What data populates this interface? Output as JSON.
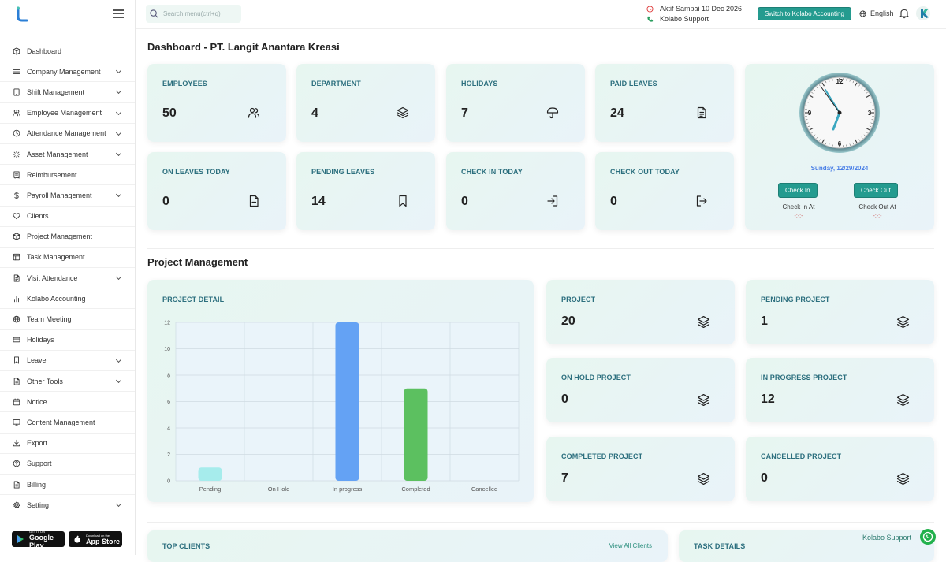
{
  "sidebar": {
    "items": [
      {
        "label": "Dashboard",
        "icon": "cube-icon",
        "chevron": false
      },
      {
        "label": "Company Management",
        "icon": "menu-icon",
        "chevron": true
      },
      {
        "label": "Shift Management",
        "icon": "tablet-icon",
        "chevron": true
      },
      {
        "label": "Employee Management",
        "icon": "users-icon",
        "chevron": true
      },
      {
        "label": "Attendance Management",
        "icon": "clock-icon",
        "chevron": true
      },
      {
        "label": "Asset Management",
        "icon": "loader-icon",
        "chevron": true
      },
      {
        "label": "Reimbursement",
        "icon": "receipt-icon",
        "chevron": false
      },
      {
        "label": "Payroll Management",
        "icon": "dollar-icon",
        "chevron": true
      },
      {
        "label": "Clients",
        "icon": "heart-icon",
        "chevron": false
      },
      {
        "label": "Project Management",
        "icon": "box-icon",
        "chevron": false
      },
      {
        "label": "Task Management",
        "icon": "table-icon",
        "chevron": false
      },
      {
        "label": "Visit Attendance",
        "icon": "document-icon",
        "chevron": true
      },
      {
        "label": "Kolabo Accounting",
        "icon": "bar-chart-icon",
        "chevron": false
      },
      {
        "label": "Team Meeting",
        "icon": "globe-icon",
        "chevron": false
      },
      {
        "label": "Holidays",
        "icon": "credit-card-icon",
        "chevron": false
      },
      {
        "label": "Leave",
        "icon": "bookmark-icon",
        "chevron": true
      },
      {
        "label": "Other Tools",
        "icon": "file-icon",
        "chevron": true
      },
      {
        "label": "Notice",
        "icon": "calendar-icon",
        "chevron": false
      },
      {
        "label": "Content Management",
        "icon": "monitor-icon",
        "chevron": false
      },
      {
        "label": "Export",
        "icon": "download-icon",
        "chevron": false
      },
      {
        "label": "Support",
        "icon": "help-icon",
        "chevron": false
      },
      {
        "label": "Billing",
        "icon": "billing-icon",
        "chevron": false
      },
      {
        "label": "Setting",
        "icon": "gear-icon",
        "chevron": true
      }
    ],
    "google_play": {
      "small": "GET IT ON",
      "big": "Google Play"
    },
    "app_store": {
      "small": "Download on the",
      "big": "App Store"
    }
  },
  "topbar": {
    "search_placeholder": "Search menu(ctrl+q)",
    "active_until": "Aktif Sampai 10 Dec 2026",
    "support": "Kolabo Support",
    "switch_button": "Switch to Kolabo Accounting",
    "language": "English"
  },
  "dashboard": {
    "title": "Dashboard - PT. Langit Anantara Kreasi",
    "stats": [
      {
        "label": "EMPLOYEES",
        "value": "50",
        "icon": "users-icon"
      },
      {
        "label": "DEPARTMENT",
        "value": "4",
        "icon": "layers-icon"
      },
      {
        "label": "HOLIDAYS",
        "value": "7",
        "icon": "umbrella-icon"
      },
      {
        "label": "PAID LEAVES",
        "value": "24",
        "icon": "document-icon"
      },
      {
        "label": "ON LEAVES TODAY",
        "value": "0",
        "icon": "file-minus-icon"
      },
      {
        "label": "PENDING LEAVES",
        "value": "14",
        "icon": "bookmark-icon"
      },
      {
        "label": "CHECK IN TODAY",
        "value": "0",
        "icon": "log-in-icon"
      },
      {
        "label": "CHECK OUT TODAY",
        "value": "0",
        "icon": "log-out-icon"
      }
    ],
    "clock": {
      "date": "Sunday, 12/29/2024",
      "check_in_button": "Check In",
      "check_out_button": "Check Out",
      "check_in_label": "Check In At",
      "check_out_label": "Check Out At",
      "check_in_time": "-:-:-",
      "check_out_time": "-:-:-",
      "numerals": [
        "12",
        "3",
        "6",
        "9"
      ]
    }
  },
  "project_management": {
    "title": "Project Management",
    "chart_title": "PROJECT DETAIL",
    "stats": [
      {
        "label": "PROJECT",
        "value": "20",
        "icon": "layers-icon"
      },
      {
        "label": "PENDING PROJECT",
        "value": "1",
        "icon": "layers-icon"
      },
      {
        "label": "ON HOLD PROJECT",
        "value": "0",
        "icon": "layers-icon"
      },
      {
        "label": "IN PROGRESS PROJECT",
        "value": "12",
        "icon": "layers-icon"
      },
      {
        "label": "COMPLETED PROJECT",
        "value": "7",
        "icon": "layers-icon"
      },
      {
        "label": "CANCELLED PROJECT",
        "value": "0",
        "icon": "layers-icon"
      }
    ]
  },
  "chart_data": {
    "type": "bar",
    "title": "PROJECT DETAIL",
    "categories": [
      "Pending",
      "On Hold",
      "In progress",
      "Completed",
      "Cancelled"
    ],
    "values": [
      1,
      0,
      12,
      7,
      0
    ],
    "colors": [
      "#a6ecec",
      "#f0b4c4",
      "#64a2f4",
      "#5cc060",
      "#cccccc"
    ],
    "ylim": [
      0,
      12
    ],
    "yticks": [
      "0",
      "2",
      "4",
      "6",
      "8",
      "10",
      "12"
    ],
    "grid": true
  },
  "bottom": {
    "top_clients": "TOP CLIENTS",
    "view_all": "View All Clients",
    "task_details": "TASK DETAILS",
    "whatsapp_label": "Kolabo Support"
  },
  "colors": {
    "accent": "#249b8f",
    "card_label": "#2c6f7e",
    "date": "#4a7fe6"
  }
}
